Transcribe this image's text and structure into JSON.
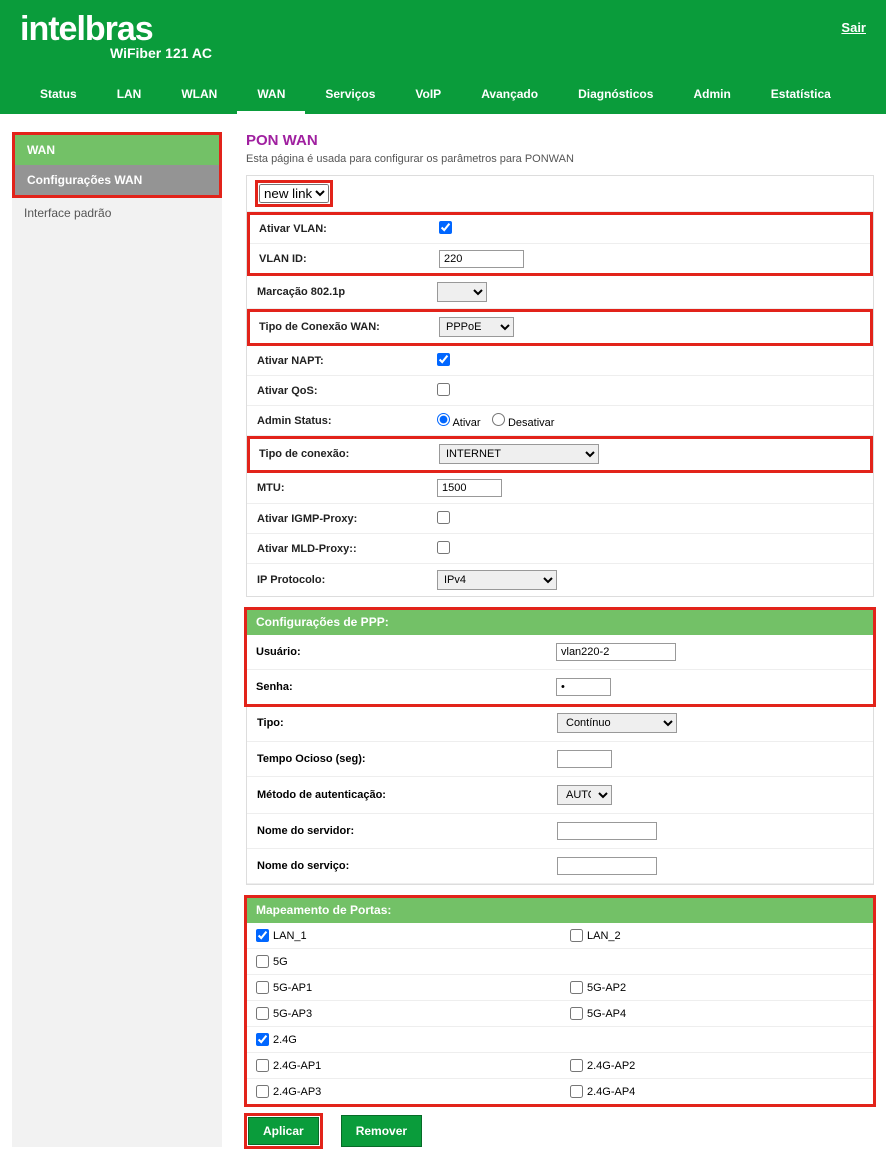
{
  "header": {
    "logo": "intelbras",
    "subtitle": "WiFiber 121 AC",
    "logout": "Sair"
  },
  "nav": [
    "Status",
    "LAN",
    "WLAN",
    "WAN",
    "Serviços",
    "VoIP",
    "Avançado",
    "Diagnósticos",
    "Admin",
    "Estatística"
  ],
  "nav_active": "WAN",
  "sidebar": {
    "items": [
      {
        "label": "WAN",
        "type": "header-green"
      },
      {
        "label": "Configurações WAN",
        "type": "sub-gray"
      },
      {
        "label": "Interface padrão",
        "type": "plain"
      }
    ]
  },
  "page": {
    "title": "PON WAN",
    "desc": "Esta página é usada para configurar os parâmetros para PONWAN"
  },
  "form": {
    "link_select": "new link",
    "ativar_vlan_label": "Ativar VLAN:",
    "ativar_vlan": true,
    "vlan_id_label": "VLAN ID:",
    "vlan_id": "220",
    "marcacao_label": "Marcação 802.1p",
    "marcacao": "",
    "tipo_conexao_wan_label": "Tipo de Conexão WAN:",
    "tipo_conexao_wan": "PPPoE",
    "ativar_napt_label": "Ativar NAPT:",
    "ativar_napt": true,
    "ativar_qos_label": "Ativar QoS:",
    "ativar_qos": false,
    "admin_status_label": "Admin Status:",
    "admin_ativar": "Ativar",
    "admin_desativar": "Desativar",
    "tipo_conexao_label": "Tipo de conexão:",
    "tipo_conexao": "INTERNET",
    "mtu_label": "MTU:",
    "mtu": "1500",
    "igmp_label": "Ativar IGMP-Proxy:",
    "igmp": false,
    "mld_label": "Ativar MLD-Proxy::",
    "mld": false,
    "ip_proto_label": "IP Protocolo:",
    "ip_proto": "IPv4"
  },
  "ppp": {
    "header": "Configurações de PPP:",
    "usuario_label": "Usuário:",
    "usuario": "vlan220-2",
    "senha_label": "Senha:",
    "senha": "•",
    "tipo_label": "Tipo:",
    "tipo": "Contínuo",
    "tempo_label": "Tempo Ocioso (seg):",
    "tempo": "",
    "metodo_label": "Método de autenticação:",
    "metodo": "AUTO",
    "servidor_label": "Nome do servidor:",
    "servidor": "",
    "servico_label": "Nome do serviço:",
    "servico": ""
  },
  "portmap": {
    "header": "Mapeamento de Portas:",
    "rows": [
      {
        "left": {
          "label": "LAN_1",
          "checked": true
        },
        "right": {
          "label": "LAN_2",
          "checked": false
        }
      },
      {
        "left": {
          "label": "5G",
          "checked": false
        },
        "right": null
      },
      {
        "left": {
          "label": "5G-AP1",
          "checked": false
        },
        "right": {
          "label": "5G-AP2",
          "checked": false
        }
      },
      {
        "left": {
          "label": "5G-AP3",
          "checked": false
        },
        "right": {
          "label": "5G-AP4",
          "checked": false
        }
      },
      {
        "left": {
          "label": "2.4G",
          "checked": true
        },
        "right": null
      },
      {
        "left": {
          "label": "2.4G-AP1",
          "checked": false
        },
        "right": {
          "label": "2.4G-AP2",
          "checked": false
        }
      },
      {
        "left": {
          "label": "2.4G-AP3",
          "checked": false
        },
        "right": {
          "label": "2.4G-AP4",
          "checked": false
        }
      }
    ]
  },
  "buttons": {
    "aplicar": "Aplicar",
    "remover": "Remover"
  }
}
